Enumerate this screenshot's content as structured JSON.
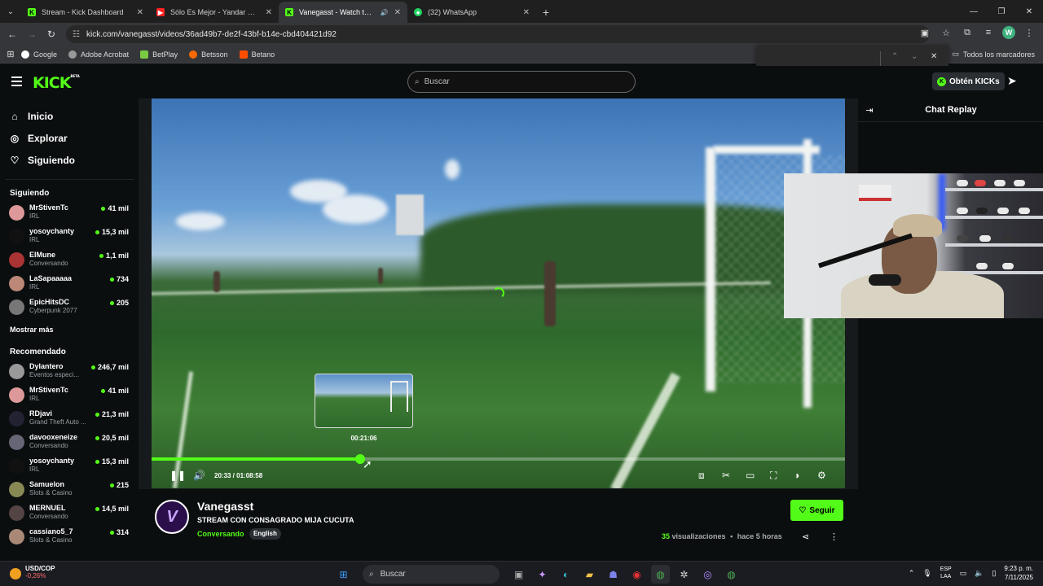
{
  "browser": {
    "tabs": [
      {
        "title": "Stream - Kick Dashboard",
        "favicon": "kick-icon",
        "active": false
      },
      {
        "title": "Sólo Es Mejor - Yandar & Yostin",
        "favicon": "youtube-icon",
        "active": false
      },
      {
        "title": "Vanegasst - Watch the VOD",
        "favicon": "kick-icon",
        "active": true
      },
      {
        "title": "(32) WhatsApp",
        "favicon": "whatsapp-icon",
        "active": false
      }
    ],
    "url": "kick.com/vanegasst/videos/36ad49b7-de2f-43bf-b14e-cbd404421d92",
    "profile_initial": "W",
    "bookmarks": [
      "Google",
      "Adobe Acrobat",
      "BetPlay",
      "Betsson",
      "Betano"
    ],
    "all_bookmarks": "Todos los marcadores"
  },
  "header": {
    "logo": "KICK",
    "logo_badge": "BETA",
    "search_placeholder": "Buscar",
    "get_kicks": "Obtén KICKs"
  },
  "sidebar": {
    "nav": [
      {
        "label": "Inicio",
        "icon": "home-icon"
      },
      {
        "label": "Explorar",
        "icon": "compass-icon"
      },
      {
        "label": "Siguiendo",
        "icon": "heart-icon"
      }
    ],
    "following_title": "Siguiendo",
    "following": [
      {
        "name": "MrStivenTc",
        "category": "IRL",
        "viewers": "41 mil"
      },
      {
        "name": "yosoychanty",
        "category": "IRL",
        "viewers": "15,3 mil"
      },
      {
        "name": "ElMune",
        "category": "Conversando",
        "viewers": "1,1 mil"
      },
      {
        "name": "LaSapaaaaa",
        "category": "IRL",
        "viewers": "734"
      },
      {
        "name": "EpicHitsDC",
        "category": "Cyberpunk 2077",
        "viewers": "205"
      }
    ],
    "show_more": "Mostrar más",
    "recommended_title": "Recomendado",
    "recommended": [
      {
        "name": "Dylantero",
        "category": "Eventos especi...",
        "viewers": "246,7 mil"
      },
      {
        "name": "MrStivenTc",
        "category": "IRL",
        "viewers": "41 mil"
      },
      {
        "name": "RDjavi",
        "category": "Grand Theft Auto ...",
        "viewers": "21,3 mil"
      },
      {
        "name": "davooxeneize",
        "category": "Conversando",
        "viewers": "20,5 mil"
      },
      {
        "name": "yosoychanty",
        "category": "IRL",
        "viewers": "15,3 mil"
      },
      {
        "name": "Samuelon",
        "category": "Slots & Casino",
        "viewers": "215"
      },
      {
        "name": "MERNUEL",
        "category": "Conversando",
        "viewers": "14,5 mil"
      },
      {
        "name": "cassiano5_7",
        "category": "Slots & Casino",
        "viewers": "314"
      }
    ]
  },
  "player": {
    "preview_time": "00:21:06",
    "current_time": "20:33",
    "duration": "01:08:58",
    "time_display": "20:33 / 01:08:58",
    "progress_fraction": 0.301
  },
  "chat": {
    "title": "Chat Replay"
  },
  "channel": {
    "name": "Vanegasst",
    "avatar_letter": "V",
    "stream_title": "STREAM CON CONSAGRADO MIJA  CUCUTA",
    "category": "Conversando",
    "tag": "English",
    "follow": "Seguir",
    "views_count": "35",
    "views_label": "visualizaciones",
    "separator": "•",
    "time_ago": "hace 5 horas"
  },
  "taskbar": {
    "ticker": "USD/COP",
    "ticker_change": "-0,26%",
    "search": "Buscar",
    "lang_top": "ESP",
    "lang_bottom": "LAA",
    "time": "9:23 p. m.",
    "date": "7/11/2025"
  },
  "colors": {
    "kick_green": "#53fc18",
    "background": "#0b0e0f"
  }
}
